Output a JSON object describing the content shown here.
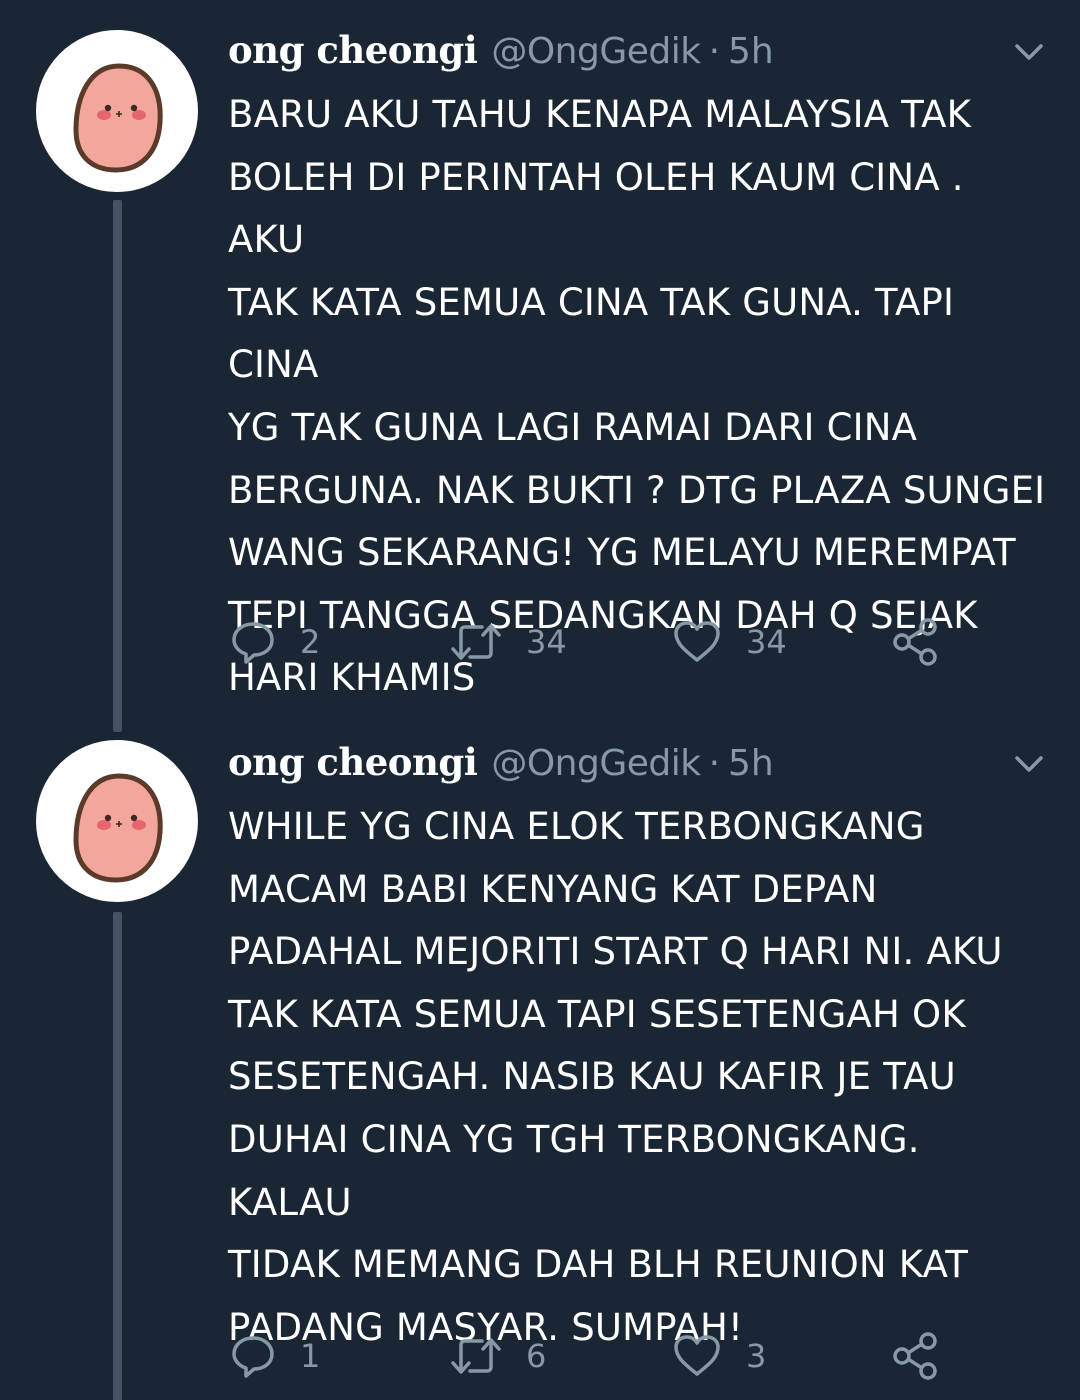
{
  "colors": {
    "background": "#1b2634",
    "text": "#ffffff",
    "secondary_text": "#8899a6",
    "thread_line": "#435264",
    "avatar_bg": "#ffffff",
    "avatar_blob": "#f3a69c"
  },
  "tweets": [
    {
      "display_name": "ong cheongi",
      "handle": "@OngGedik",
      "separator": "·",
      "time": "5h",
      "text": "BARU AKU TAHU KENAPA MALAYSIA TAK\nBOLEH DI PERINTAH OLEH KAUM CINA . AKU\nTAK KATA SEMUA CINA TAK GUNA. TAPI CINA\nYG TAK GUNA LAGI RAMAI DARI CINA\nBERGUNA. NAK BUKTI ? DTG PLAZA SUNGEI\nWANG SEKARANG! YG MELAYU MEREMPAT\nTEPI TANGGA SEDANGKAN DAH Q SEJAK\nHARI KHAMIS",
      "replies": "2",
      "retweets": "34",
      "likes": "34",
      "icons": {
        "avatar": "potato-character-avatar",
        "caret": "chevron-down-icon",
        "reply": "reply-icon",
        "retweet": "retweet-icon",
        "like": "heart-icon",
        "share": "share-icon"
      }
    },
    {
      "display_name": "ong cheongi",
      "handle": "@OngGedik",
      "separator": "·",
      "time": "5h",
      "text": "WHILE YG CINA ELOK TERBONGKANG\nMACAM BABI KENYANG KAT DEPAN\nPADAHAL MEJORITI START Q HARI NI. AKU\nTAK KATA SEMUA TAPI SESETENGAH OK\nSESETENGAH. NASIB KAU KAFIR JE TAU\nDUHAI CINA YG TGH TERBONGKANG. KALAU\nTIDAK MEMANG DAH BLH REUNION KAT\nPADANG MASYAR. SUMPAH!",
      "replies": "1",
      "retweets": "6",
      "likes": "3",
      "icons": {
        "avatar": "potato-character-avatar",
        "caret": "chevron-down-icon",
        "reply": "reply-icon",
        "retweet": "retweet-icon",
        "like": "heart-icon",
        "share": "share-icon"
      }
    }
  ]
}
